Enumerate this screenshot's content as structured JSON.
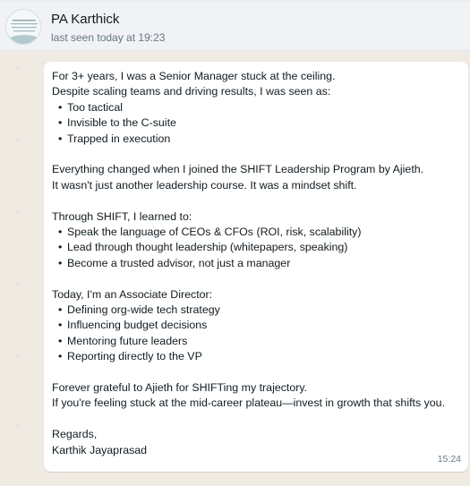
{
  "header": {
    "contact_name": "PA Karthick",
    "last_seen": "last seen today at 19:23",
    "avatar_icon": "profile-picture-icon"
  },
  "message": {
    "paragraph1": {
      "lines": [
        "For 3+ years, I was a Senior Manager stuck at the ceiling.",
        "Despite scaling teams and driving results, I was seen as:"
      ],
      "bullets": [
        "Too tactical",
        "Invisible to the C-suite",
        "Trapped in execution"
      ]
    },
    "paragraph2": {
      "lines": [
        "Everything changed when I joined the SHIFT Leadership Program by Ajieth.",
        "It wasn't just another leadership course. It was a mindset shift."
      ]
    },
    "paragraph3": {
      "lines": [
        "Through SHIFT, I learned to:"
      ],
      "bullets": [
        "Speak the language of CEOs & CFOs (ROI, risk, scalability)",
        "Lead through thought leadership (whitepapers, speaking)",
        "Become a trusted advisor, not just a manager"
      ]
    },
    "paragraph4": {
      "lines": [
        "Today, I'm an Associate Director:"
      ],
      "bullets": [
        "Defining org-wide tech strategy",
        "Influencing budget decisions",
        "Mentoring future leaders",
        "Reporting directly to the VP"
      ]
    },
    "paragraph5": {
      "lines": [
        "Forever grateful to Ajieth for SHIFTing my trajectory.",
        "If you're feeling stuck at the mid-career plateau—invest in growth that shifts you."
      ]
    },
    "signoff": {
      "lines": [
        "Regards,",
        "Karthik Jayaprasad"
      ]
    },
    "bullet_char": "•",
    "time": "15:24"
  },
  "colors": {
    "chat_background": "#efeae2",
    "bubble": "#ffffff",
    "header": "#f0f2f5",
    "text": "#111b21",
    "secondary_text": "#667781"
  }
}
